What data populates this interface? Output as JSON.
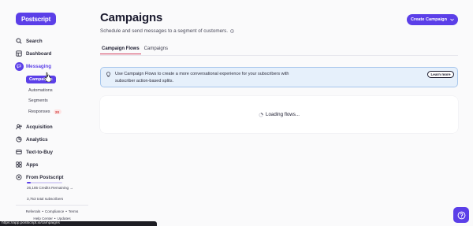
{
  "app": {
    "logo_text": "Postscript",
    "brand_color": "#5b3fe8"
  },
  "sidebar": {
    "nav": [
      {
        "label": "Search",
        "icon": "search-icon"
      },
      {
        "label": "Dashboard",
        "icon": "dashboard-icon"
      },
      {
        "label": "Messaging",
        "icon": "chat-icon",
        "active": true
      }
    ],
    "messaging_subitems": [
      {
        "label": "Campaigns",
        "active": true
      },
      {
        "label": "Automations"
      },
      {
        "label": "Segments"
      },
      {
        "label": "Responses",
        "badge": "20"
      }
    ],
    "nav_bottom": [
      {
        "label": "Acquisition",
        "icon": "acquisition-icon"
      },
      {
        "label": "Analytics",
        "icon": "analytics-icon"
      },
      {
        "label": "Text-to-Buy",
        "icon": "text-to-buy-icon"
      },
      {
        "label": "Apps",
        "icon": "apps-icon"
      },
      {
        "label": "From Postscript",
        "icon": "postscript-icon"
      }
    ],
    "credits_remaining": "26,185 Credits Remaining →",
    "credits_progress": 0.12,
    "subscribers": "3,753 total subscribers",
    "footer_row1": [
      "Referrals",
      "Compliance",
      "Terms"
    ],
    "footer_row2": [
      "Help Center",
      "Updates"
    ]
  },
  "status_url": "https://app.postscript.io/campaigns",
  "header": {
    "title": "Campaigns",
    "subtitle": "Schedule and send messages to a segment of customers.",
    "create_button": "Create Campaign"
  },
  "tabs": [
    {
      "label": "Campaign Flows",
      "active": true
    },
    {
      "label": "Campaigns"
    }
  ],
  "banner": {
    "text": "Use Campaign Flows to create a more conversational experience for your subscribers with subscriber action-based splits.",
    "learn_more": "Learn more"
  },
  "loading": {
    "text": "Loading flows..."
  }
}
